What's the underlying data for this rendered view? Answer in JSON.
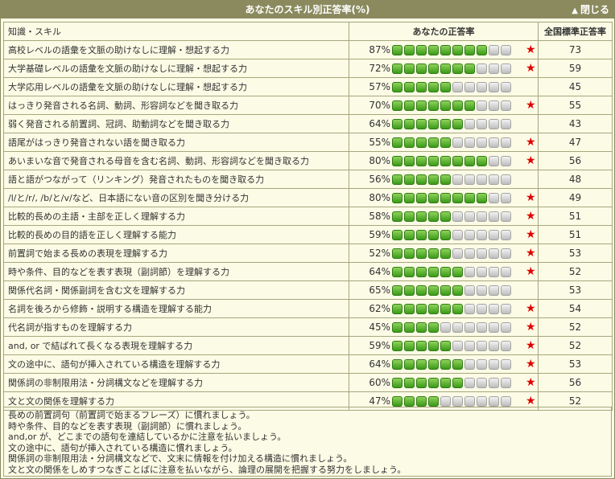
{
  "header": {
    "title": "あなたのスキル別正答率(%)",
    "close_label": "閉じる",
    "close_icon": "triangle-up-icon"
  },
  "columns": {
    "skill": "知識・スキル",
    "your_rate": "あなたの正答率",
    "national": "全国標準正答率"
  },
  "colors": {
    "bar_filled": "#4caf28",
    "bar_empty": "#c8c8c8",
    "star": "#e00000",
    "header_bg": "#8a8a5e",
    "panel_bg": "#fbfbe6"
  },
  "rows": [
    {
      "skill": "高校レベルの語彙を文脈の助けなしに理解・想起する力",
      "rate": "87%",
      "rate_value": 87,
      "bar_filled": 8,
      "star": "★",
      "national": "73"
    },
    {
      "skill": "大学基礎レベルの語彙を文脈の助けなしに理解・想起する力",
      "rate": "72%",
      "rate_value": 72,
      "bar_filled": 7,
      "star": "★",
      "national": "59"
    },
    {
      "skill": "大学応用レベルの語彙を文脈の助けなしに理解・想起する力",
      "rate": "57%",
      "rate_value": 57,
      "bar_filled": 5,
      "star": "",
      "national": "45"
    },
    {
      "skill": "はっきり発音される名詞、動詞、形容詞などを聞き取る力",
      "rate": "70%",
      "rate_value": 70,
      "bar_filled": 7,
      "star": "★",
      "national": "55"
    },
    {
      "skill": "弱く発音される前置詞、冠詞、助動詞などを聞き取る力",
      "rate": "64%",
      "rate_value": 64,
      "bar_filled": 6,
      "star": "",
      "national": "43"
    },
    {
      "skill": "語尾がはっきり発音されない語を聞き取る力",
      "rate": "55%",
      "rate_value": 55,
      "bar_filled": 5,
      "star": "★",
      "national": "47"
    },
    {
      "skill": "あいまいな音で発音される母音を含む名詞、動詞、形容詞などを聞き取る力",
      "rate": "80%",
      "rate_value": 80,
      "bar_filled": 8,
      "star": "★",
      "national": "56"
    },
    {
      "skill": "語と語がつながって（リンキング）発音されたものを聞き取る力",
      "rate": "56%",
      "rate_value": 56,
      "bar_filled": 5,
      "star": "",
      "national": "48"
    },
    {
      "skill": "/l/と/r/, /b/と/v/など、日本語にない音の区別を聞き分ける力",
      "rate": "80%",
      "rate_value": 80,
      "bar_filled": 8,
      "star": "★",
      "national": "49"
    },
    {
      "skill": "比較的長めの主語・主部を正しく理解する力",
      "rate": "58%",
      "rate_value": 58,
      "bar_filled": 5,
      "star": "★",
      "national": "51"
    },
    {
      "skill": "比較的長めの目的語を正しく理解する能力",
      "rate": "59%",
      "rate_value": 59,
      "bar_filled": 5,
      "star": "★",
      "national": "51"
    },
    {
      "skill": "前置詞で始まる長めの表現を理解する力",
      "rate": "52%",
      "rate_value": 52,
      "bar_filled": 5,
      "star": "★",
      "national": "53"
    },
    {
      "skill": "時や条件、目的などを表す表現（副詞節）を理解する力",
      "rate": "64%",
      "rate_value": 64,
      "bar_filled": 6,
      "star": "★",
      "national": "52"
    },
    {
      "skill": "関係代名詞・関係副詞を含む文を理解する力",
      "rate": "65%",
      "rate_value": 65,
      "bar_filled": 6,
      "star": "",
      "national": "53"
    },
    {
      "skill": "名詞を後ろから修飾・説明する構造を理解する能力",
      "rate": "62%",
      "rate_value": 62,
      "bar_filled": 6,
      "star": "★",
      "national": "54"
    },
    {
      "skill": "代名詞が指すものを理解する力",
      "rate": "45%",
      "rate_value": 45,
      "bar_filled": 4,
      "star": "★",
      "national": "52"
    },
    {
      "skill": "and, or で結ばれて長くなる表現を理解する力",
      "rate": "59%",
      "rate_value": 59,
      "bar_filled": 5,
      "star": "★",
      "national": "52"
    },
    {
      "skill": "文の途中に、語句が挿入されている構造を理解する力",
      "rate": "64%",
      "rate_value": 64,
      "bar_filled": 6,
      "star": "★",
      "national": "53"
    },
    {
      "skill": "関係詞の非制限用法・分詞構文などを理解する力",
      "rate": "60%",
      "rate_value": 60,
      "bar_filled": 6,
      "star": "★",
      "national": "56"
    },
    {
      "skill": "文と文の関係を理解する力",
      "rate": "47%",
      "rate_value": 47,
      "bar_filled": 4,
      "star": "★",
      "national": "52"
    }
  ],
  "advice": [
    "長めの前置詞句（前置詞で始まるフレーズ）に慣れましょう。",
    "時や条件、目的などを表す表現（副詞節）に慣れましょう。",
    "and,or が、どこまでの語句を連結しているかに注意を払いましょう。",
    "文の途中に、語句が挿入されている構造に慣れましょう。",
    "関係詞の非制限用法・分詞構文などで、文末に情報を付け加える構造に慣れましょう。",
    "文と文の関係をしめすつなぎことばに注意を払いながら、論理の展開を把握する努力をしましょう。"
  ]
}
